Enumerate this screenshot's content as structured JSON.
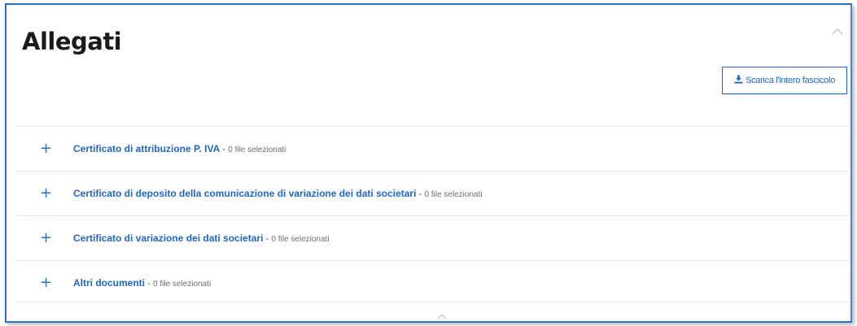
{
  "section": {
    "title": "Allegati",
    "download_label": "Scarica l'intero fascicolo"
  },
  "icons": {
    "collapse": "chevron-up-icon",
    "download": "download-icon",
    "expand": "plus-icon"
  },
  "colors": {
    "accent": "#1f66c4",
    "border": "#2c6fc4",
    "muted_text": "#6b6f75",
    "divider": "#e4e6ea"
  },
  "attachments": [
    {
      "expand": "+",
      "label": "Certificato di attribuzione P. IVA",
      "separator": "-",
      "count": "0 file selezionati"
    },
    {
      "expand": "+",
      "label": "Certificato di deposito della comunicazione di variazione dei dati societari",
      "separator": "-",
      "count": "0 file selezionati"
    },
    {
      "expand": "+",
      "label": "Certificato di variazione dei dati societari",
      "separator": "-",
      "count": "0 file selezionati"
    },
    {
      "expand": "+",
      "label": "Altri documenti",
      "separator": "-",
      "count": "0 file selezionati"
    }
  ]
}
